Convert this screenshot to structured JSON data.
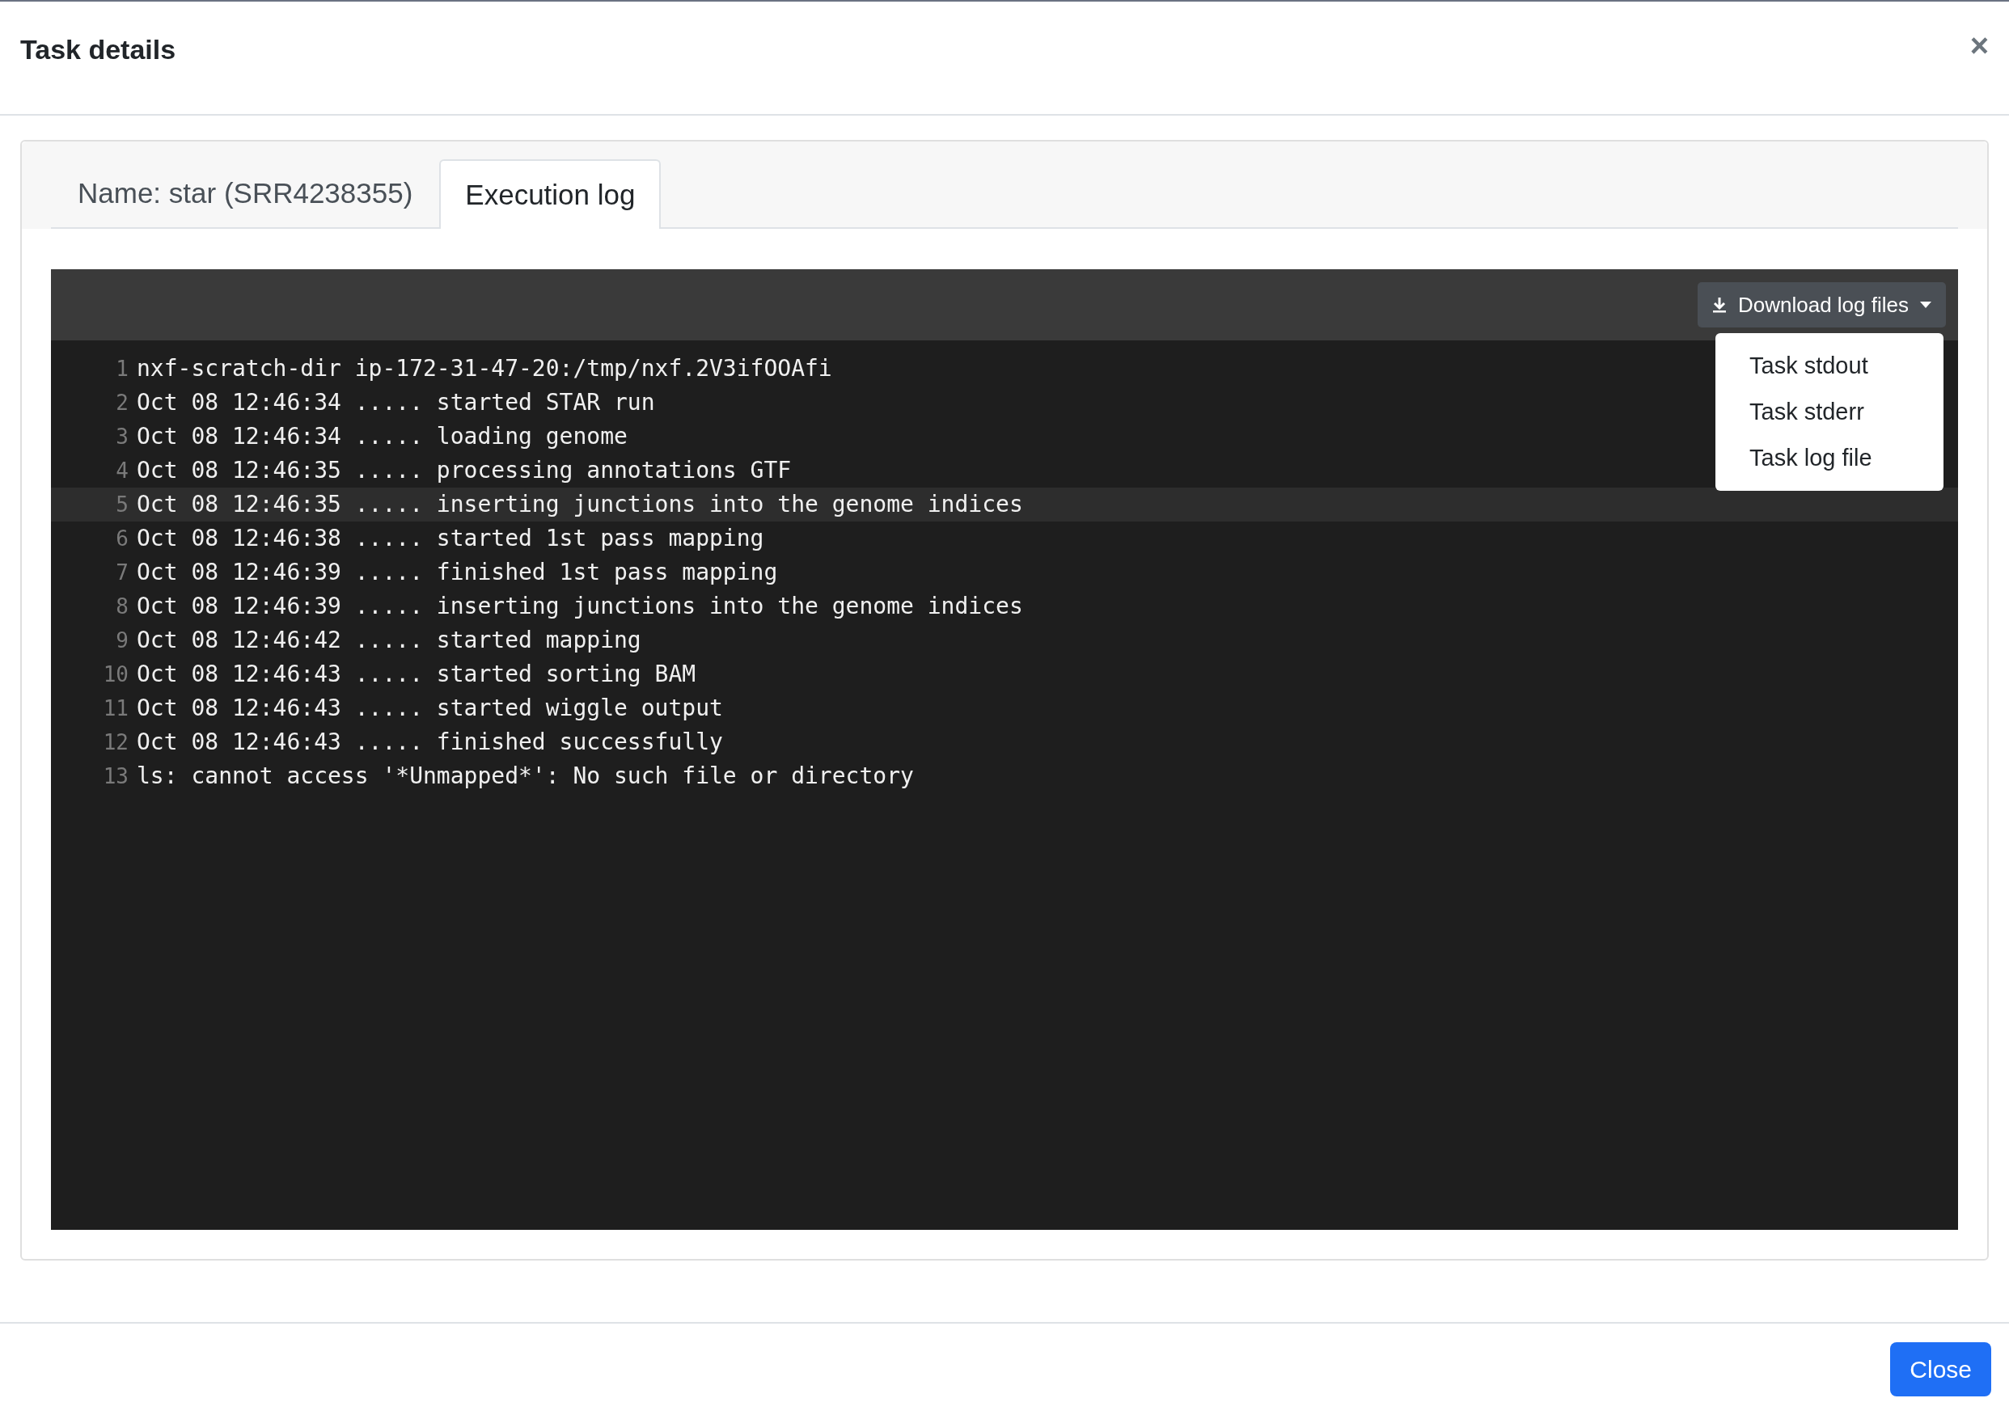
{
  "dialog": {
    "title": "Task details",
    "close_icon": "×"
  },
  "tabs": [
    {
      "label": "Name: star (SRR4238355)",
      "selected": false
    },
    {
      "label": "Execution log",
      "selected": true
    }
  ],
  "toolbar": {
    "download_button": {
      "label": "Download log files",
      "expanded": true
    },
    "menu": [
      "Task stdout",
      "Task stderr",
      "Task log file"
    ]
  },
  "log_lines": [
    {
      "number": "1",
      "text": "nxf-scratch-dir ip-172-31-47-20:/tmp/nxf.2V3ifOOAfi",
      "highlighted": false
    },
    {
      "number": "2",
      "text": "Oct 08 12:46:34 ..... started STAR run",
      "highlighted": false
    },
    {
      "number": "3",
      "text": "Oct 08 12:46:34 ..... loading genome",
      "highlighted": false
    },
    {
      "number": "4",
      "text": "Oct 08 12:46:35 ..... processing annotations GTF",
      "highlighted": false
    },
    {
      "number": "5",
      "text": "Oct 08 12:46:35 ..... inserting junctions into the genome indices",
      "highlighted": true
    },
    {
      "number": "6",
      "text": "Oct 08 12:46:38 ..... started 1st pass mapping",
      "highlighted": false
    },
    {
      "number": "7",
      "text": "Oct 08 12:46:39 ..... finished 1st pass mapping",
      "highlighted": false
    },
    {
      "number": "8",
      "text": "Oct 08 12:46:39 ..... inserting junctions into the genome indices",
      "highlighted": false
    },
    {
      "number": "9",
      "text": "Oct 08 12:46:42 ..... started mapping",
      "highlighted": false
    },
    {
      "number": "10",
      "text": "Oct 08 12:46:43 ..... started sorting BAM",
      "highlighted": false
    },
    {
      "number": "11",
      "text": "Oct 08 12:46:43 ..... started wiggle output",
      "highlighted": false
    },
    {
      "number": "12",
      "text": "Oct 08 12:46:43 ..... finished successfully",
      "highlighted": false
    },
    {
      "number": "13",
      "text": "ls: cannot access '*Unmapped*': No such file or directory",
      "highlighted": false
    }
  ],
  "footer": {
    "close_button": "Close"
  }
}
